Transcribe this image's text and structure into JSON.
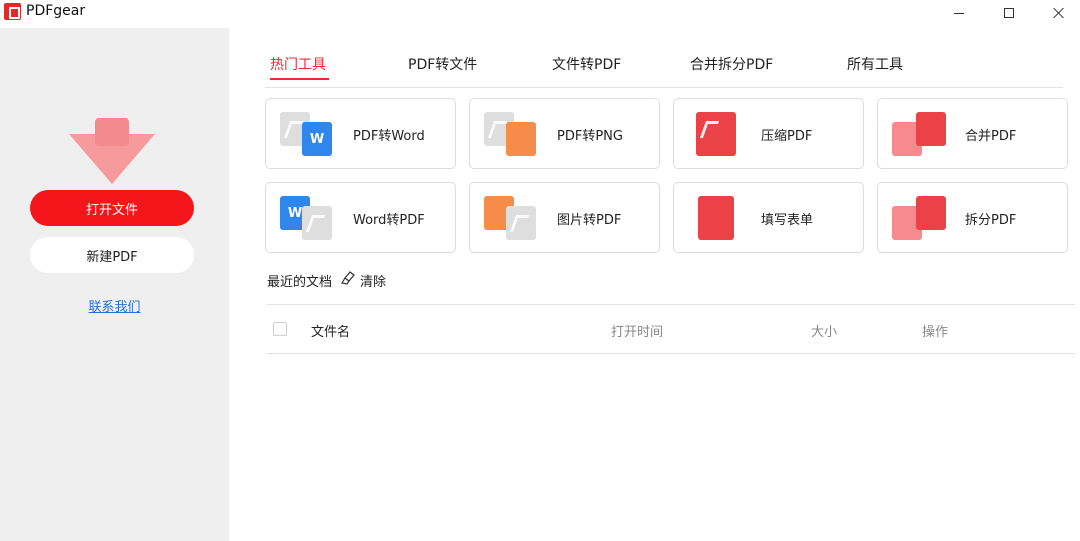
{
  "window": {
    "app_name": "PDFgear",
    "logo_icon": "pdfgear-logo-icon",
    "controls": [
      "minimize-icon",
      "maximize-icon",
      "close-icon"
    ]
  },
  "sidebar": {
    "drop_icon": "drop-file-arrow-icon",
    "open_file_label": "打开文件",
    "new_pdf_label": "新建PDF",
    "contact_label": "联系我们"
  },
  "tabs": [
    {
      "label": "热门工具",
      "active": true
    },
    {
      "label": "PDF转文件",
      "active": false
    },
    {
      "label": "文件转PDF",
      "active": false
    },
    {
      "label": "合并拆分PDF",
      "active": false
    },
    {
      "label": "所有工具",
      "active": false
    }
  ],
  "tools": [
    {
      "label": "PDF转Word",
      "icon": "pdf-to-word-icon"
    },
    {
      "label": "PDF转PNG",
      "icon": "pdf-to-png-icon"
    },
    {
      "label": "压缩PDF",
      "icon": "compress-pdf-icon"
    },
    {
      "label": "合并PDF",
      "icon": "merge-pdf-icon"
    },
    {
      "label": "Word转PDF",
      "icon": "word-to-pdf-icon"
    },
    {
      "label": "图片转PDF",
      "icon": "image-to-pdf-icon"
    },
    {
      "label": "填写表单",
      "icon": "fill-form-icon"
    },
    {
      "label": "拆分PDF",
      "icon": "split-pdf-icon"
    }
  ],
  "recent": {
    "title": "最近的文档",
    "clear_label": "清除",
    "clear_icon": "broom-icon",
    "columns": [
      "文件名",
      "打开时间",
      "大小",
      "操作"
    ]
  },
  "colors": {
    "accent": "#f5161c",
    "link": "#2b6fd6",
    "sidebar_bg": "#efefef"
  }
}
